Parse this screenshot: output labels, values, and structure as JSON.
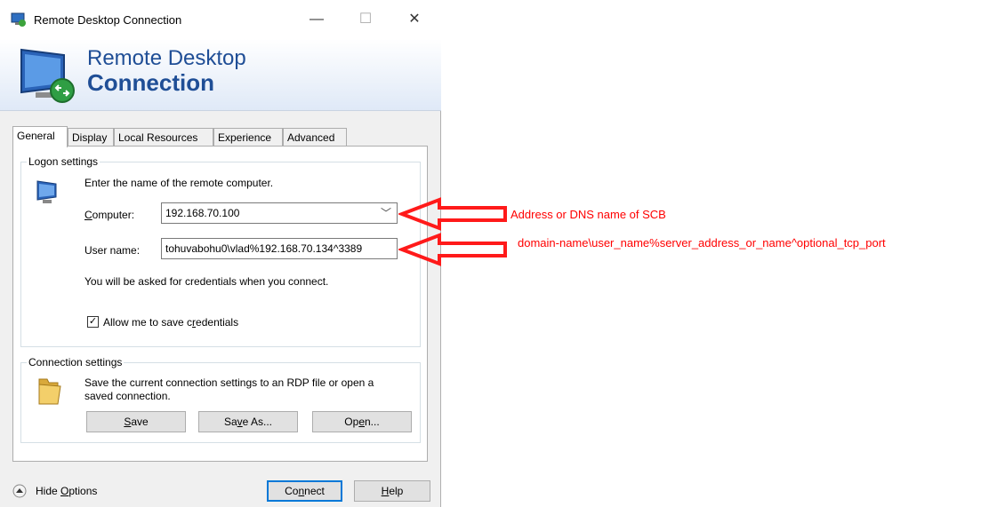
{
  "window": {
    "title": "Remote Desktop Connection",
    "controls": {
      "minimize": "—",
      "maximize": "☐",
      "close": "✕"
    }
  },
  "banner": {
    "line1": "Remote Desktop",
    "line2": "Connection"
  },
  "tabs": [
    {
      "label": "General",
      "active": true
    },
    {
      "label": "Display"
    },
    {
      "label": "Local Resources"
    },
    {
      "label": "Experience"
    },
    {
      "label": "Advanced"
    }
  ],
  "logon": {
    "legend": "Logon settings",
    "instruction": "Enter the name of the remote computer.",
    "computer_label_pre": "",
    "computer_label_ul": "C",
    "computer_label_post": "omputer:",
    "computer_value": "192.168.70.100",
    "username_label": "User name:",
    "username_value": "tohuvabohu0\\vlad%192.168.70.134^3389",
    "credentials_note": "You will be asked for credentials when you connect.",
    "save_creds_pre": "Allow me to save c",
    "save_creds_ul": "r",
    "save_creds_post": "edentials",
    "save_creds_checked": "✓"
  },
  "connection": {
    "legend": "Connection settings",
    "line1": "Save the current connection settings to an RDP file or open a",
    "line2": "saved connection.",
    "save_ul": "S",
    "save_post": "ave",
    "saveas_pre": "Sa",
    "saveas_ul": "v",
    "saveas_post": "e As...",
    "open_pre": "Op",
    "open_ul": "e",
    "open_post": "n..."
  },
  "footer": {
    "hide_pre": "Hide ",
    "hide_ul": "O",
    "hide_post": "ptions",
    "connect_pre": "Co",
    "connect_ul": "n",
    "connect_post": "nect",
    "help_ul": "H",
    "help_post": "elp"
  },
  "annotations": {
    "computer_note": "Address or DNS name of SCB",
    "username_note": "domain-name\\user_name%server_address_or_name^optional_tcp_port",
    "color": "#ff0000"
  }
}
